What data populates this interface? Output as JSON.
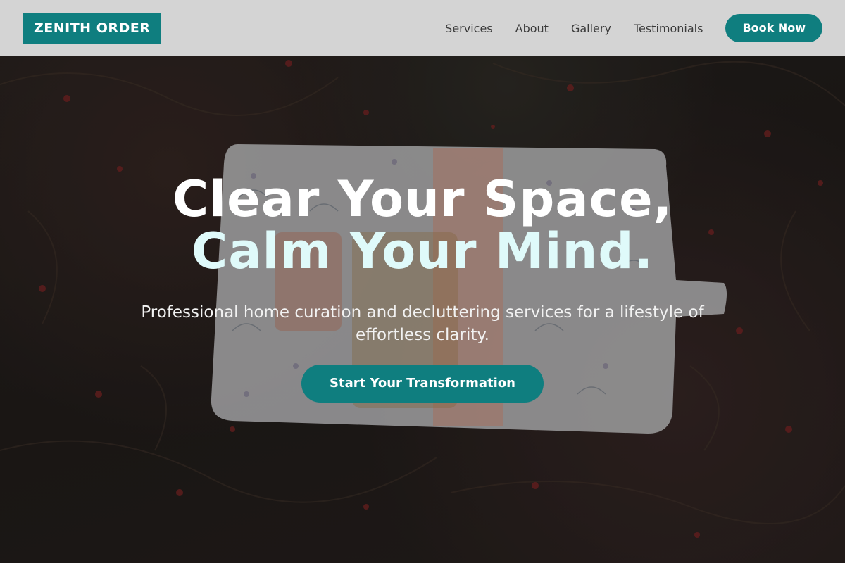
{
  "brand": {
    "name": "ZENITH ORDER",
    "accent_color": "#0f7e7f"
  },
  "nav": {
    "links": [
      "Services",
      "About",
      "Gallery",
      "Testimonials"
    ],
    "cta_label": "Book Now"
  },
  "hero": {
    "headline_line1": "Clear Your Space,",
    "headline_line2": "Calm Your Mind.",
    "subtitle": "Professional home curation and decluttering services for a lifestyle of effortless clarity.",
    "cta_label": "Start Your Transformation",
    "background_image": "floral-fabric-pouch-on-dark-foliage"
  }
}
